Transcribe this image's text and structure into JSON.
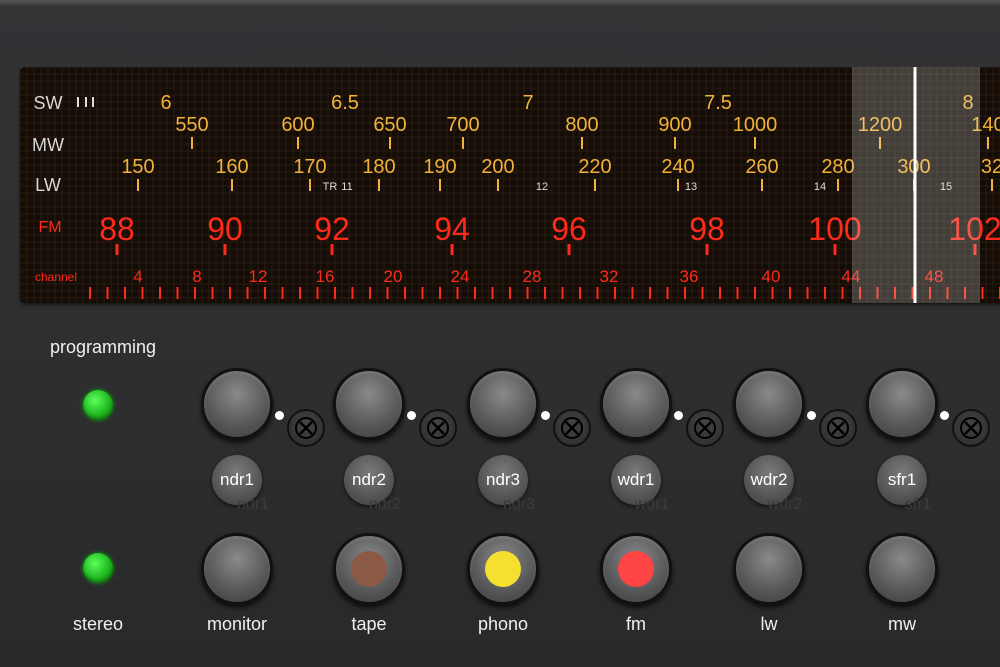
{
  "dial": {
    "bands": {
      "sw": "SW",
      "mw": "MW",
      "lw": "LW",
      "fm": "FM",
      "channel": "channel"
    },
    "sw_scale": [
      "6",
      "6.5",
      "7",
      "7.5",
      "8"
    ],
    "mw_scale": [
      "550",
      "600",
      "650",
      "700",
      "800",
      "900",
      "1000",
      "1200",
      "140"
    ],
    "lw_scale": [
      "150",
      "160",
      "170",
      "180",
      "190",
      "200",
      "220",
      "240",
      "260",
      "280",
      "300",
      "32"
    ],
    "lw_markers": [
      "TR",
      "11",
      "12",
      "13",
      "14",
      "15"
    ],
    "fm_scale": [
      "88",
      "90",
      "92",
      "94",
      "96",
      "98",
      "100",
      "102"
    ],
    "channel_scale": [
      "4",
      "8",
      "12",
      "16",
      "20",
      "24",
      "28",
      "32",
      "36",
      "40",
      "44",
      "48"
    ],
    "colors": {
      "amber": "#f2b23a",
      "red": "#ff2a1a",
      "needle": "#ffffff"
    }
  },
  "leds": {
    "programming_label": "programming",
    "stereo_label": "stereo"
  },
  "presets": [
    "ndr1",
    "ndr2",
    "ndr3",
    "wdr1",
    "wdr2",
    "sfr1"
  ],
  "sources": [
    {
      "label": "monitor",
      "indicator": ""
    },
    {
      "label": "tape",
      "indicator": "#8a5a45"
    },
    {
      "label": "phono",
      "indicator": "#f5e030"
    },
    {
      "label": "fm",
      "indicator": "#ff4444"
    },
    {
      "label": "lw",
      "indicator": ""
    },
    {
      "label": "mw",
      "indicator": ""
    }
  ]
}
